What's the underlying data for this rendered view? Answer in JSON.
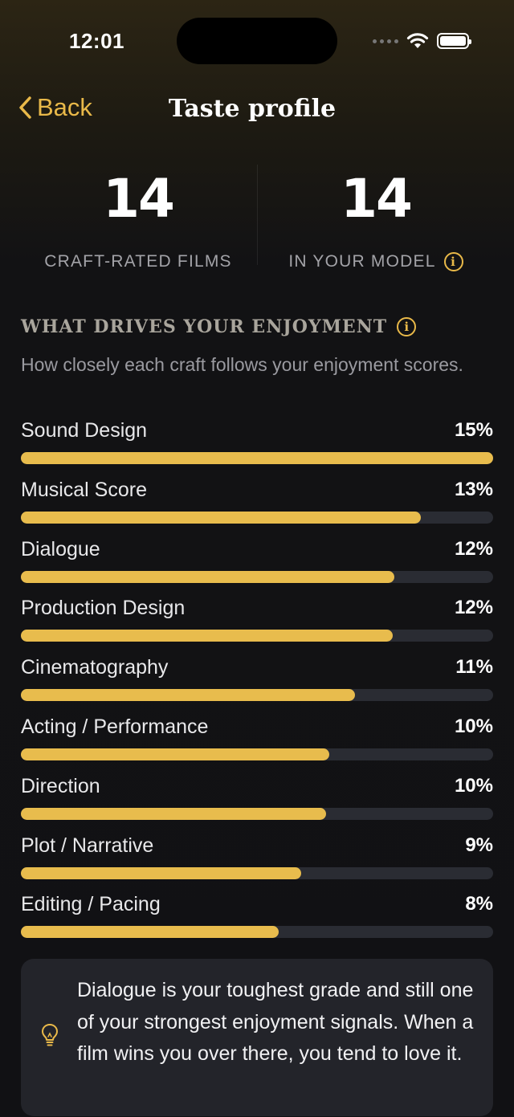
{
  "status": {
    "time": "12:01"
  },
  "nav": {
    "back_label": "Back",
    "title": "Taste profile"
  },
  "stats": [
    {
      "value": "14",
      "label": "CRAFT-RATED FILMS",
      "has_info": false
    },
    {
      "value": "14",
      "label": "IN YOUR MODEL",
      "has_info": true
    }
  ],
  "section": {
    "title": "WHAT DRIVES YOUR ENJOYMENT",
    "subtitle": "How closely each craft follows your enjoyment scores."
  },
  "crafts": [
    {
      "name": "Sound Design",
      "percent": "15%",
      "value": 15
    },
    {
      "name": "Musical Score",
      "percent": "13%",
      "value": 12.7
    },
    {
      "name": "Dialogue",
      "percent": "12%",
      "value": 11.85
    },
    {
      "name": "Production Design",
      "percent": "12%",
      "value": 11.8
    },
    {
      "name": "Cinematography",
      "percent": "11%",
      "value": 10.6
    },
    {
      "name": "Acting / Performance",
      "percent": "10%",
      "value": 9.8
    },
    {
      "name": "Direction",
      "percent": "10%",
      "value": 9.7
    },
    {
      "name": "Plot / Narrative",
      "percent": "9%",
      "value": 8.9
    },
    {
      "name": "Editing / Pacing",
      "percent": "8%",
      "value": 8.2
    }
  ],
  "insight": {
    "icon": "lightbulb-icon",
    "text": "Dialogue is your toughest grade and still one of your strongest enjoyment signals. When a film wins you over there, you tend to love it."
  },
  "colors": {
    "accent": "#e9b949",
    "bar_fill": "#e8bc4d",
    "bar_track": "#2a2c33",
    "card": "#23242a"
  }
}
